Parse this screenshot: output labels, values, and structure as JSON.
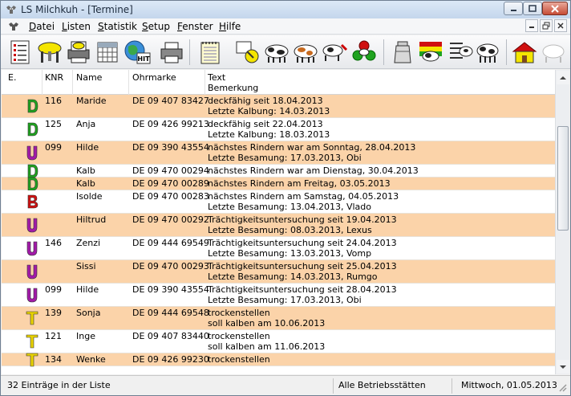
{
  "window": {
    "title": "LS Milchkuh - [Termine]"
  },
  "menu": {
    "items": [
      {
        "hot": "D",
        "rest": "atei"
      },
      {
        "hot": "L",
        "rest": "isten"
      },
      {
        "hot": "S",
        "rest": "tatistik"
      },
      {
        "hot": "S",
        "rest": "etup"
      },
      {
        "hot": "F",
        "rest": "enster"
      },
      {
        "hot": "H",
        "rest": "ilfe"
      }
    ]
  },
  "toolbar": {
    "hit_label": "HIT",
    "icons": [
      "list-icon",
      "milking-stall-icon",
      "printer-cow-icon",
      "grid-icon",
      "globe-hit-icon",
      "printer-icon",
      "notepad-icon",
      "hand-cow-icon",
      "cow-group-icon",
      "brown-cow-icon",
      "cow-weight-icon",
      "red-green-balls-icon",
      "milk-can-icon",
      "flag-cow-icon",
      "cow-grid-icon",
      "cow-stats-icon",
      "farmhouse-icon"
    ]
  },
  "table": {
    "headers": {
      "e": "E.",
      "knr": "KNR",
      "name": "Name",
      "ohrmarke": "Ohrmarke",
      "text": "Text",
      "bemerkung": "Bemerkung"
    },
    "icon_colors": {
      "D": "#1fa31f",
      "U": "#a21aa8",
      "B": "#d01010",
      "T": "#e8d200"
    },
    "rows": [
      {
        "code": "D",
        "knr": "116",
        "name": "Maride",
        "ohrmarke": "DE 09 407 83427",
        "line1": "deckfähig seit 18.04.2013",
        "line2": "Letzte Kalbung: 14.03.2013",
        "style": "alt"
      },
      {
        "code": "D",
        "knr": "125",
        "name": "Anja",
        "ohrmarke": "DE 09 426 99213",
        "line1": "deckfähig seit 22.04.2013",
        "line2": "Letzte Kalbung: 18.03.2013",
        "style": "plain"
      },
      {
        "code": "U",
        "knr": "099",
        "name": "Hilde",
        "ohrmarke": "DE 09 390 43554",
        "line1": "nächstes Rindern war am Sonntag, 28.04.2013",
        "line2": "Letzte Besamung: 17.03.2013, Obi",
        "style": "alt"
      },
      {
        "code": "D",
        "knr": "",
        "name": "Kalb",
        "ohrmarke": "DE 09 470 00294",
        "line1": "nächstes Rindern war am Dienstag, 30.04.2013",
        "line2": "",
        "style": "plain"
      },
      {
        "code": "D",
        "knr": "",
        "name": "Kalb",
        "ohrmarke": "DE 09 470 00289",
        "line1": "nächstes Rindern am Freitag, 03.05.2013",
        "line2": "",
        "style": "alt"
      },
      {
        "code": "B",
        "knr": "",
        "name": "Isolde",
        "ohrmarke": "DE 09 470 00283",
        "line1": "nächstes Rindern am Samstag, 04.05.2013",
        "line2": "Letzte Besamung: 13.04.2013, Vlado",
        "style": "plain"
      },
      {
        "code": "U",
        "knr": "",
        "name": "Hiltrud",
        "ohrmarke": "DE 09 470 00292",
        "line1": "Trächtigkeitsuntersuchung seit 19.04.2013",
        "line2": "Letzte Besamung: 08.03.2013, Lexus",
        "style": "alt"
      },
      {
        "code": "U",
        "knr": "146",
        "name": "Zenzi",
        "ohrmarke": "DE 09 444 69549",
        "line1": "Trächtigkeitsuntersuchung seit 24.04.2013",
        "line2": "Letzte Besamung: 13.03.2013, Vomp",
        "style": "plain"
      },
      {
        "code": "U",
        "knr": "",
        "name": "Sissi",
        "ohrmarke": "DE 09 470 00293",
        "line1": "Trächtigkeitsuntersuchung seit 25.04.2013",
        "line2": "Letzte Besamung: 14.03.2013, Rumgo",
        "style": "alt"
      },
      {
        "code": "U",
        "knr": "099",
        "name": "Hilde",
        "ohrmarke": "DE 09 390 43554",
        "line1": "Trächtigkeitsuntersuchung seit 28.04.2013",
        "line2": "Letzte Besamung: 17.03.2013, Obi",
        "style": "plain"
      },
      {
        "code": "T",
        "knr": "139",
        "name": "Sonja",
        "ohrmarke": "DE 09 444 69548",
        "line1": "trockenstellen",
        "line2": "soll kalben am 10.06.2013",
        "style": "alt"
      },
      {
        "code": "T",
        "knr": "121",
        "name": "Inge",
        "ohrmarke": "DE 09 407 83440",
        "line1": "trockenstellen",
        "line2": "soll kalben am 11.06.2013",
        "style": "plain"
      },
      {
        "code": "T",
        "knr": "134",
        "name": "Wenke",
        "ohrmarke": "DE 09 426 99230",
        "line1": "trockenstellen",
        "line2": "",
        "style": "alt"
      }
    ]
  },
  "status": {
    "count": "32 Einträge in der Liste",
    "scope": "Alle Betriebsstätten",
    "date": "Mittwoch, 01.05.2013"
  }
}
